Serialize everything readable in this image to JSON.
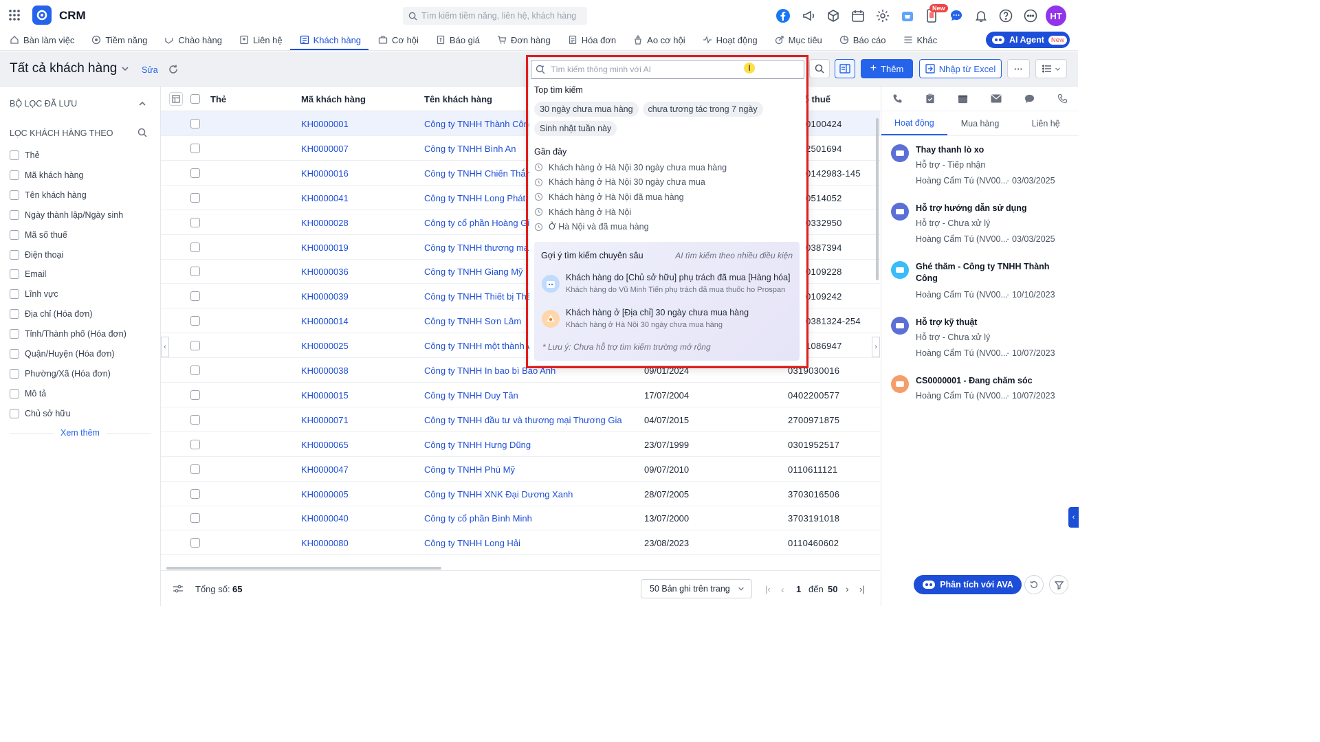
{
  "app": {
    "title": "CRM"
  },
  "search": {
    "placeholder": "Tìm kiếm tiềm năng, liên hệ, khách hàng"
  },
  "header": {
    "new_badge": "New",
    "avatar": "HT"
  },
  "nav": [
    {
      "label": "Bàn làm việc",
      "icon": "home-icon"
    },
    {
      "label": "Tiềm năng",
      "icon": "target-icon"
    },
    {
      "label": "Chào hàng",
      "icon": "handshake-icon"
    },
    {
      "label": "Liên hệ",
      "icon": "contact-icon"
    },
    {
      "label": "Khách hàng",
      "icon": "customer-icon",
      "active": true
    },
    {
      "label": "Cơ hội",
      "icon": "briefcase-icon"
    },
    {
      "label": "Báo giá",
      "icon": "quote-icon"
    },
    {
      "label": "Đơn hàng",
      "icon": "cart-icon"
    },
    {
      "label": "Hóa đơn",
      "icon": "invoice-icon"
    },
    {
      "label": "Ao cơ hội",
      "icon": "pool-icon"
    },
    {
      "label": "Hoạt động",
      "icon": "activity-icon"
    },
    {
      "label": "Mục tiêu",
      "icon": "goal-icon"
    },
    {
      "label": "Báo cáo",
      "icon": "report-icon"
    },
    {
      "label": "Khác",
      "icon": "menu-icon"
    }
  ],
  "ai_agent": {
    "label": "AI Agent",
    "badge": "New"
  },
  "view": {
    "title": "Tất cả khách hàng",
    "edit": "Sửa"
  },
  "toolbar": {
    "add": "Thêm",
    "import": "Nhập từ Excel"
  },
  "sidebar": {
    "saved_filters": "BỘ LỌC ĐÃ LƯU",
    "filter_by": "LỌC KHÁCH HÀNG THEO",
    "filters": [
      "Thẻ",
      "Mã khách hàng",
      "Tên khách hàng",
      "Ngày thành lập/Ngày sinh",
      "Mã số thuế",
      "Điện thoại",
      "Email",
      "Lĩnh vực",
      "Địa chỉ (Hóa đơn)",
      "Tỉnh/Thành phố (Hóa đơn)",
      "Quận/Huyện (Hóa đơn)",
      "Phường/Xã (Hóa đơn)",
      "Mô tả",
      "Chủ sở hữu"
    ],
    "more": "Xem thêm"
  },
  "table": {
    "columns": {
      "tag": "Thẻ",
      "code": "Mã khách hàng",
      "name": "Tên khách hàng",
      "tax": "ố thuế"
    },
    "rows": [
      {
        "code": "KH0000001",
        "name": "Công ty TNHH Thành Công",
        "date": "",
        "tax": "0100424"
      },
      {
        "code": "KH0000007",
        "name": "Công ty TNHH Bình An",
        "date": "",
        "tax": "2501694"
      },
      {
        "code": "KH0000016",
        "name": "Công ty TNHH Chiến Thắng",
        "date": "",
        "tax": "0142983-145"
      },
      {
        "code": "KH0000041",
        "name": "Công ty TNHH Long Phát",
        "date": "",
        "tax": "0514052"
      },
      {
        "code": "KH0000028",
        "name": "Công ty cổ phần Hoàng Gia",
        "date": "",
        "tax": "0332950"
      },
      {
        "code": "KH0000019",
        "name": "Công ty TNHH thương mại",
        "date": "",
        "tax": "0387394"
      },
      {
        "code": "KH0000036",
        "name": "Công ty TNHH Giang Mỹ",
        "date": "",
        "tax": "0109228"
      },
      {
        "code": "KH0000039",
        "name": "Công ty TNHH Thiết bị Thà",
        "date": "",
        "tax": "0109242"
      },
      {
        "code": "KH0000014",
        "name": "Công ty TNHH Sơn Lâm",
        "date": "",
        "tax": "0381324-254"
      },
      {
        "code": "KH0000025",
        "name": "Công ty TNHH một thành v",
        "date": "",
        "tax": "1086947"
      },
      {
        "code": "KH0000038",
        "name": "Công ty TNHH In bao bì Bảo Anh",
        "date": "09/01/2024",
        "tax": "0319030016"
      },
      {
        "code": "KH0000015",
        "name": "Công ty TNHH Duy Tân",
        "date": "17/07/2004",
        "tax": "0402200577"
      },
      {
        "code": "KH0000071",
        "name": "Công ty TNHH đầu tư và thương mại Thương Gia",
        "date": "04/07/2015",
        "tax": "2700971875"
      },
      {
        "code": "KH0000065",
        "name": "Công ty TNHH Hưng Dũng",
        "date": "23/07/1999",
        "tax": "0301952517"
      },
      {
        "code": "KH0000047",
        "name": "Công ty TNHH Phú Mỹ",
        "date": "09/07/2010",
        "tax": "0110611121"
      },
      {
        "code": "KH0000005",
        "name": "Công ty TNHH XNK Đại Dương Xanh",
        "date": "28/07/2005",
        "tax": "3703016506"
      },
      {
        "code": "KH0000040",
        "name": "Công ty cổ phần Bình Minh",
        "date": "13/07/2000",
        "tax": "3703191018"
      },
      {
        "code": "KH0000080",
        "name": "Công ty TNHH Long Hải",
        "date": "23/08/2023",
        "tax": "0110460602"
      }
    ]
  },
  "footer": {
    "total_label": "Tổng số:",
    "total": "65",
    "page_size": "50 Bản ghi trên trang",
    "page_from": "1",
    "page_to_label": "đến",
    "page_to": "50"
  },
  "right": {
    "tabs": [
      "Hoạt động",
      "Mua hàng",
      "Liên hệ"
    ],
    "activities": [
      {
        "title": "Thay thanh lò xo",
        "sub": "Hỗ trợ - Tiếp nhận",
        "owner": "Hoàng Cẩm Tú (NV00...",
        "date": "03/03/2025",
        "color": "#5b6fd6"
      },
      {
        "title": "Hỗ trợ hướng dẫn sử dụng",
        "sub": "Hỗ trợ - Chưa xử lý",
        "owner": "Hoàng Cẩm Tú (NV00...",
        "date": "03/03/2025",
        "color": "#5b6fd6"
      },
      {
        "title": "Ghé thăm - Công ty TNHH Thành Công",
        "sub": "",
        "owner": "Hoàng Cẩm Tú (NV00...",
        "date": "10/10/2023",
        "color": "#38bdf8"
      },
      {
        "title": "Hỗ trợ kỹ thuật",
        "sub": "Hỗ trợ - Chưa xử lý",
        "owner": "Hoàng Cẩm Tú (NV00...",
        "date": "10/07/2023",
        "color": "#5b6fd6"
      },
      {
        "title": "CS0000001 - Đang chăm sóc",
        "sub": "",
        "owner": "Hoàng Cẩm Tú (NV00...",
        "date": "10/07/2023",
        "color": "#f59e6b"
      }
    ],
    "ava": "Phân tích với AVA"
  },
  "popup": {
    "placeholder": "Tìm kiếm thông minh với AI",
    "top_label": "Top tìm kiếm",
    "chips": [
      "30 ngày chưa mua hàng",
      "chưa tương tác trong 7 ngày",
      "Sinh nhật tuần này"
    ],
    "recent_label": "Gần đây",
    "recent": [
      "Khách hàng ở Hà Nội 30 ngày chưa mua hàng",
      "Khách hàng ở Hà Nội 30 ngày chưa mua",
      "Khách hàng ở Hà Nội đã mua hàng",
      "Khách hàng ở Hà Nội",
      "Ở Hà Nội và đã mua hàng"
    ],
    "deep_label": "Gợi ý tìm kiếm chuyên sâu",
    "deep_hint": "AI tìm kiếm theo nhiều điều kiện",
    "suggestions": [
      {
        "title": "Khách hàng do [Chủ sở hữu] phụ trách đã mua [Hàng hóa]",
        "example": "Khách hàng do Vũ Minh Tiến phụ trách đã mua thuốc ho Prospan"
      },
      {
        "title": "Khách hàng ở [Địa chỉ] 30 ngày chưa mua hàng",
        "example": "Khách hàng ở Hà Nội 30 ngày chưa mua hàng"
      }
    ],
    "note": "* Lưu ý: Chưa hỗ trợ tìm kiếm trường mở rộng"
  }
}
